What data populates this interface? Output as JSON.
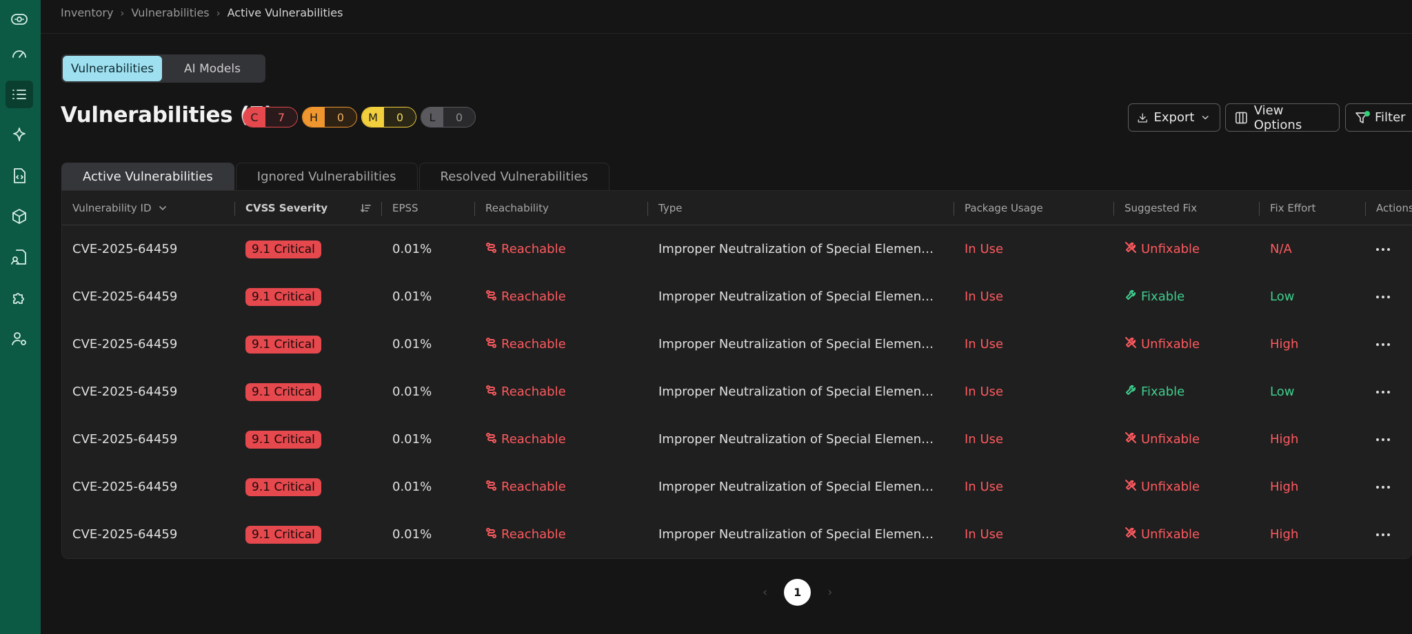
{
  "breadcrumb": [
    "Inventory",
    "Vulnerabilities",
    "Active Vulnerabilities"
  ],
  "view_toggle": {
    "active": "Vulnerabilities",
    "inactive": "AI Models"
  },
  "page_title": "Vulnerabilities (7)",
  "severity_counts": [
    {
      "letter": "C",
      "count": "7",
      "color": "#e5484d"
    },
    {
      "letter": "H",
      "count": "0",
      "color": "#f0962f"
    },
    {
      "letter": "M",
      "count": "0",
      "color": "#f2cf3d"
    },
    {
      "letter": "L",
      "count": "0",
      "color": "#5a5a5e"
    }
  ],
  "toolbar": {
    "export": "Export",
    "view_options": "View Options",
    "filter": "Filter"
  },
  "tabs": [
    "Active Vulnerabilities",
    "Ignored Vulnerabilities",
    "Resolved Vulnerabilities"
  ],
  "columns": [
    "Vulnerability ID",
    "CVSS Severity",
    "EPSS",
    "Reachability",
    "Type",
    "Package Usage",
    "Suggested Fix",
    "Fix Effort",
    "Actions"
  ],
  "rows": [
    {
      "id": "CVE-2025-64459",
      "cvss": "9.1 Critical",
      "epss": "0.01%",
      "reach": "Reachable",
      "type": "Improper Neutralization of Special Elements used in an SQL Command",
      "usage": "In Use",
      "fix": "Unfixable",
      "effort": "N/A"
    },
    {
      "id": "CVE-2025-64459",
      "cvss": "9.1 Critical",
      "epss": "0.01%",
      "reach": "Reachable",
      "type": "Improper Neutralization of Special Elements used in an SQL Command",
      "usage": "In Use",
      "fix": "Fixable",
      "effort": "Low"
    },
    {
      "id": "CVE-2025-64459",
      "cvss": "9.1 Critical",
      "epss": "0.01%",
      "reach": "Reachable",
      "type": "Improper Neutralization of Special Elements used in an SQL Command",
      "usage": "In Use",
      "fix": "Unfixable",
      "effort": "High"
    },
    {
      "id": "CVE-2025-64459",
      "cvss": "9.1 Critical",
      "epss": "0.01%",
      "reach": "Reachable",
      "type": "Improper Neutralization of Special Elements used in an SQL Command",
      "usage": "In Use",
      "fix": "Fixable",
      "effort": "Low"
    },
    {
      "id": "CVE-2025-64459",
      "cvss": "9.1 Critical",
      "epss": "0.01%",
      "reach": "Reachable",
      "type": "Improper Neutralization of Special Elements used in an SQL Command",
      "usage": "In Use",
      "fix": "Unfixable",
      "effort": "High"
    },
    {
      "id": "CVE-2025-64459",
      "cvss": "9.1 Critical",
      "epss": "0.01%",
      "reach": "Reachable",
      "type": "Improper Neutralization of Special Elements used in an SQL Command",
      "usage": "In Use",
      "fix": "Unfixable",
      "effort": "High"
    },
    {
      "id": "CVE-2025-64459",
      "cvss": "9.1 Critical",
      "epss": "0.01%",
      "reach": "Reachable",
      "type": "Improper Neutralization of Special Elements used in an SQL Command",
      "usage": "In Use",
      "fix": "Unfixable",
      "effort": "High"
    }
  ],
  "pagination": {
    "current": "1"
  },
  "colors": {
    "sidebar": "#0d5a44",
    "critical": "#e5484d",
    "danger_text": "#ff5a5f",
    "success_text": "#3ecf8e",
    "toggle_active": "#9ee0ef"
  }
}
